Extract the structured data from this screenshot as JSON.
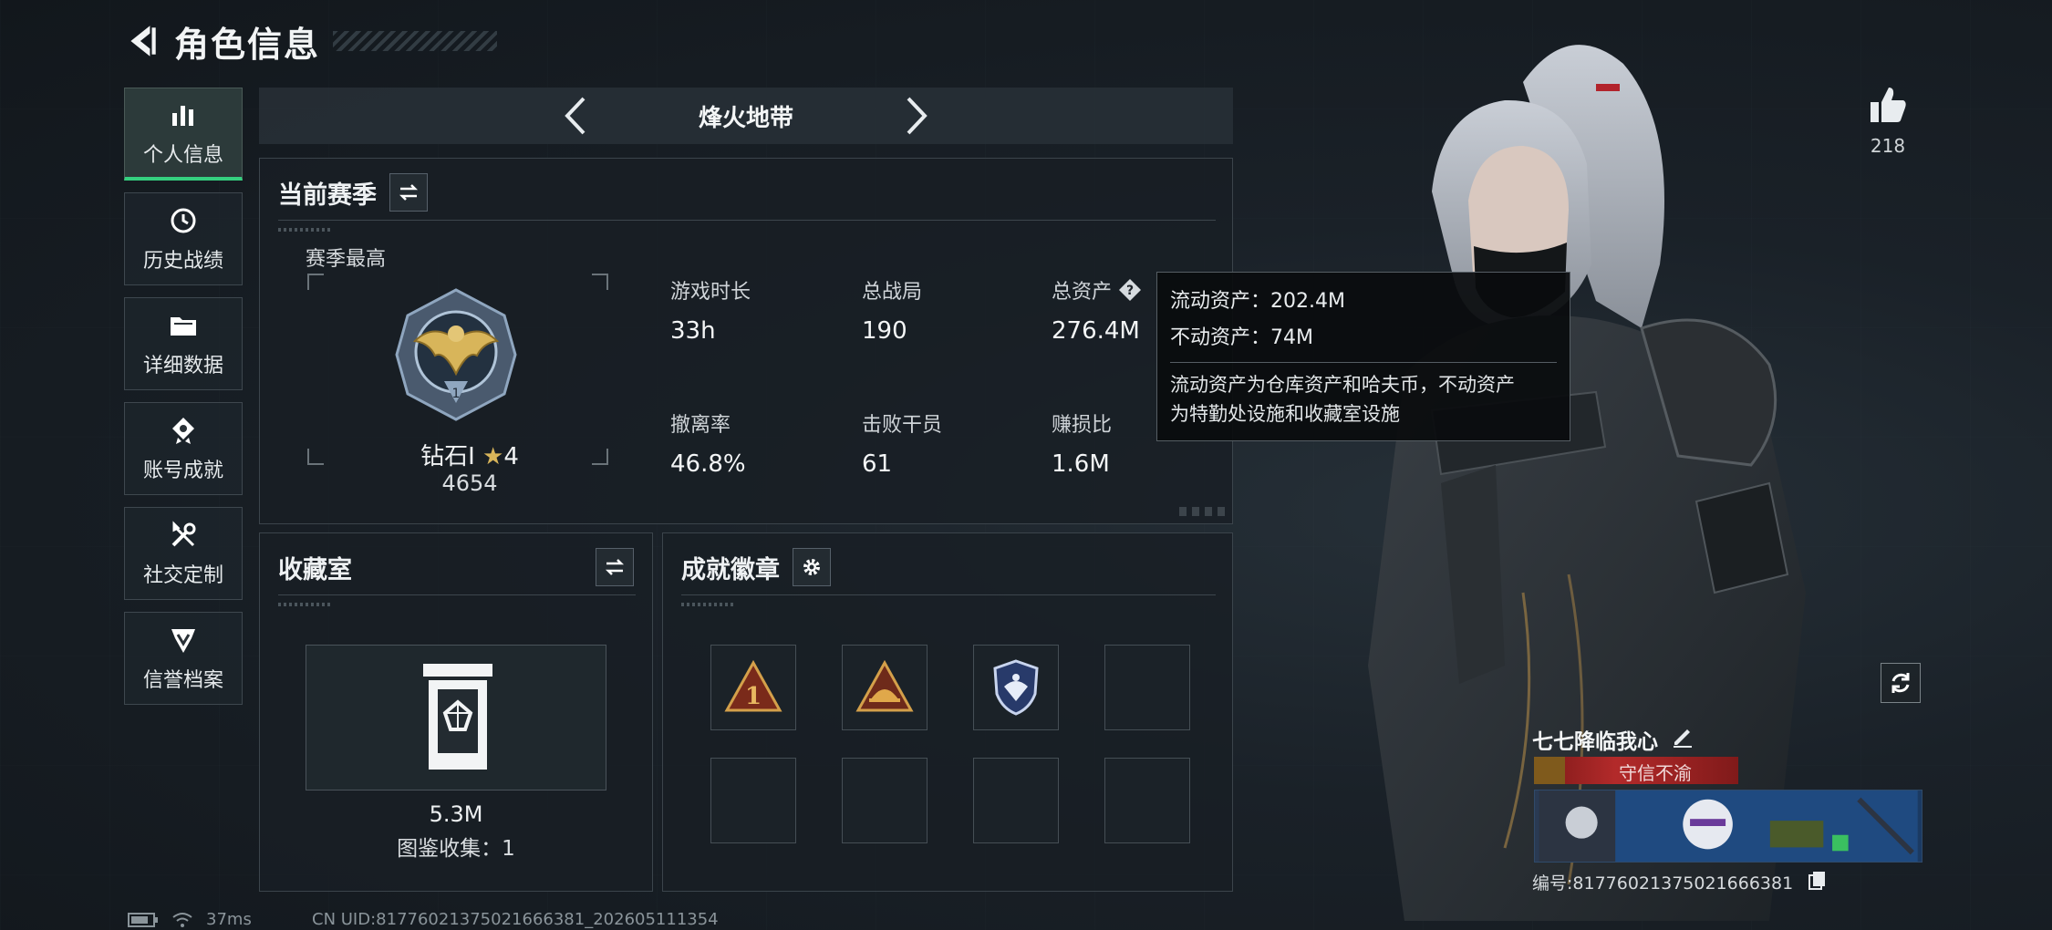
{
  "header": {
    "title": "角色信息"
  },
  "sidebar": {
    "items": [
      {
        "label": "个人信息",
        "icon": "bar-chart-icon",
        "active": true
      },
      {
        "label": "历史战绩",
        "icon": "history-icon",
        "active": false
      },
      {
        "label": "详细数据",
        "icon": "folder-icon",
        "active": false
      },
      {
        "label": "账号成就",
        "icon": "achievement-icon",
        "active": false
      },
      {
        "label": "社交定制",
        "icon": "tools-icon",
        "active": false
      },
      {
        "label": "信誉档案",
        "icon": "reputation-icon",
        "active": false
      }
    ]
  },
  "season_nav": {
    "title": "烽火地带"
  },
  "season_panel": {
    "title": "当前赛季",
    "best_label": "赛季最高",
    "rank_name": "钻石Ⅰ",
    "rank_stars": "4",
    "rank_score": "4654",
    "stats": [
      {
        "label": "游戏时长",
        "value": "33h"
      },
      {
        "label": "总战局",
        "value": "190"
      },
      {
        "label": "总资产",
        "value": "276.4M"
      },
      {
        "label": "撤离率",
        "value": "46.8%"
      },
      {
        "label": "击败干员",
        "value": "61"
      },
      {
        "label": "赚损比",
        "value": "1.6M"
      }
    ]
  },
  "tooltip": {
    "liquid": "流动资产：202.4M",
    "fixed": "不动资产：74M",
    "desc_line1": "流动资产为仓库资产和哈夫币，不动资产",
    "desc_line2": "为特勤处设施和收藏室设施"
  },
  "collection_panel": {
    "title": "收藏室",
    "value": "5.3M",
    "count_text": "图鉴收集：1"
  },
  "badges_panel": {
    "title": "成就徽章",
    "badges": [
      "rank-1-triangle-badge",
      "helmet-triangle-badge",
      "shield-eagle-badge"
    ]
  },
  "player": {
    "name": "七七降临我心",
    "title": "守信不渝",
    "id_text": "编号:817760213750216663​81"
  },
  "likes": {
    "count": "218"
  },
  "status": {
    "ping": "37ms",
    "uid": "CN UID:8177602137502166638​1_202605111354"
  },
  "colors": {
    "accent": "#35d07f",
    "title_red": "#b32a2a",
    "gold": "#d8b55a"
  }
}
